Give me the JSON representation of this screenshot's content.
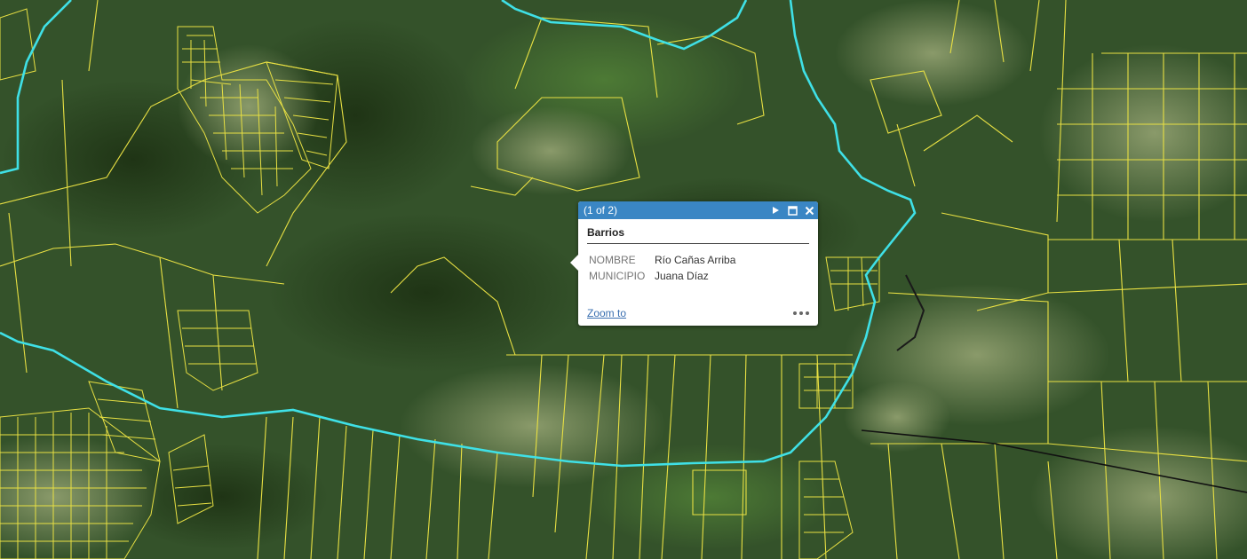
{
  "map": {
    "imagery": "satellite",
    "parcel_color": "#e8e043",
    "river_color": "#3fe0e6",
    "road_color": "#111111"
  },
  "popup": {
    "pager": "(1 of 2)",
    "next_icon": "play-icon",
    "maximize_icon": "maximize-icon",
    "close_icon": "close-icon",
    "layer_title": "Barrios",
    "fields": [
      {
        "key": "NOMBRE",
        "value": "Río Cañas Arriba"
      },
      {
        "key": "MUNICIPIO",
        "value": "Juana Díaz"
      }
    ],
    "zoom_label": "Zoom to",
    "more_icon": "ellipsis-icon",
    "header_color": "#3a86c4"
  }
}
